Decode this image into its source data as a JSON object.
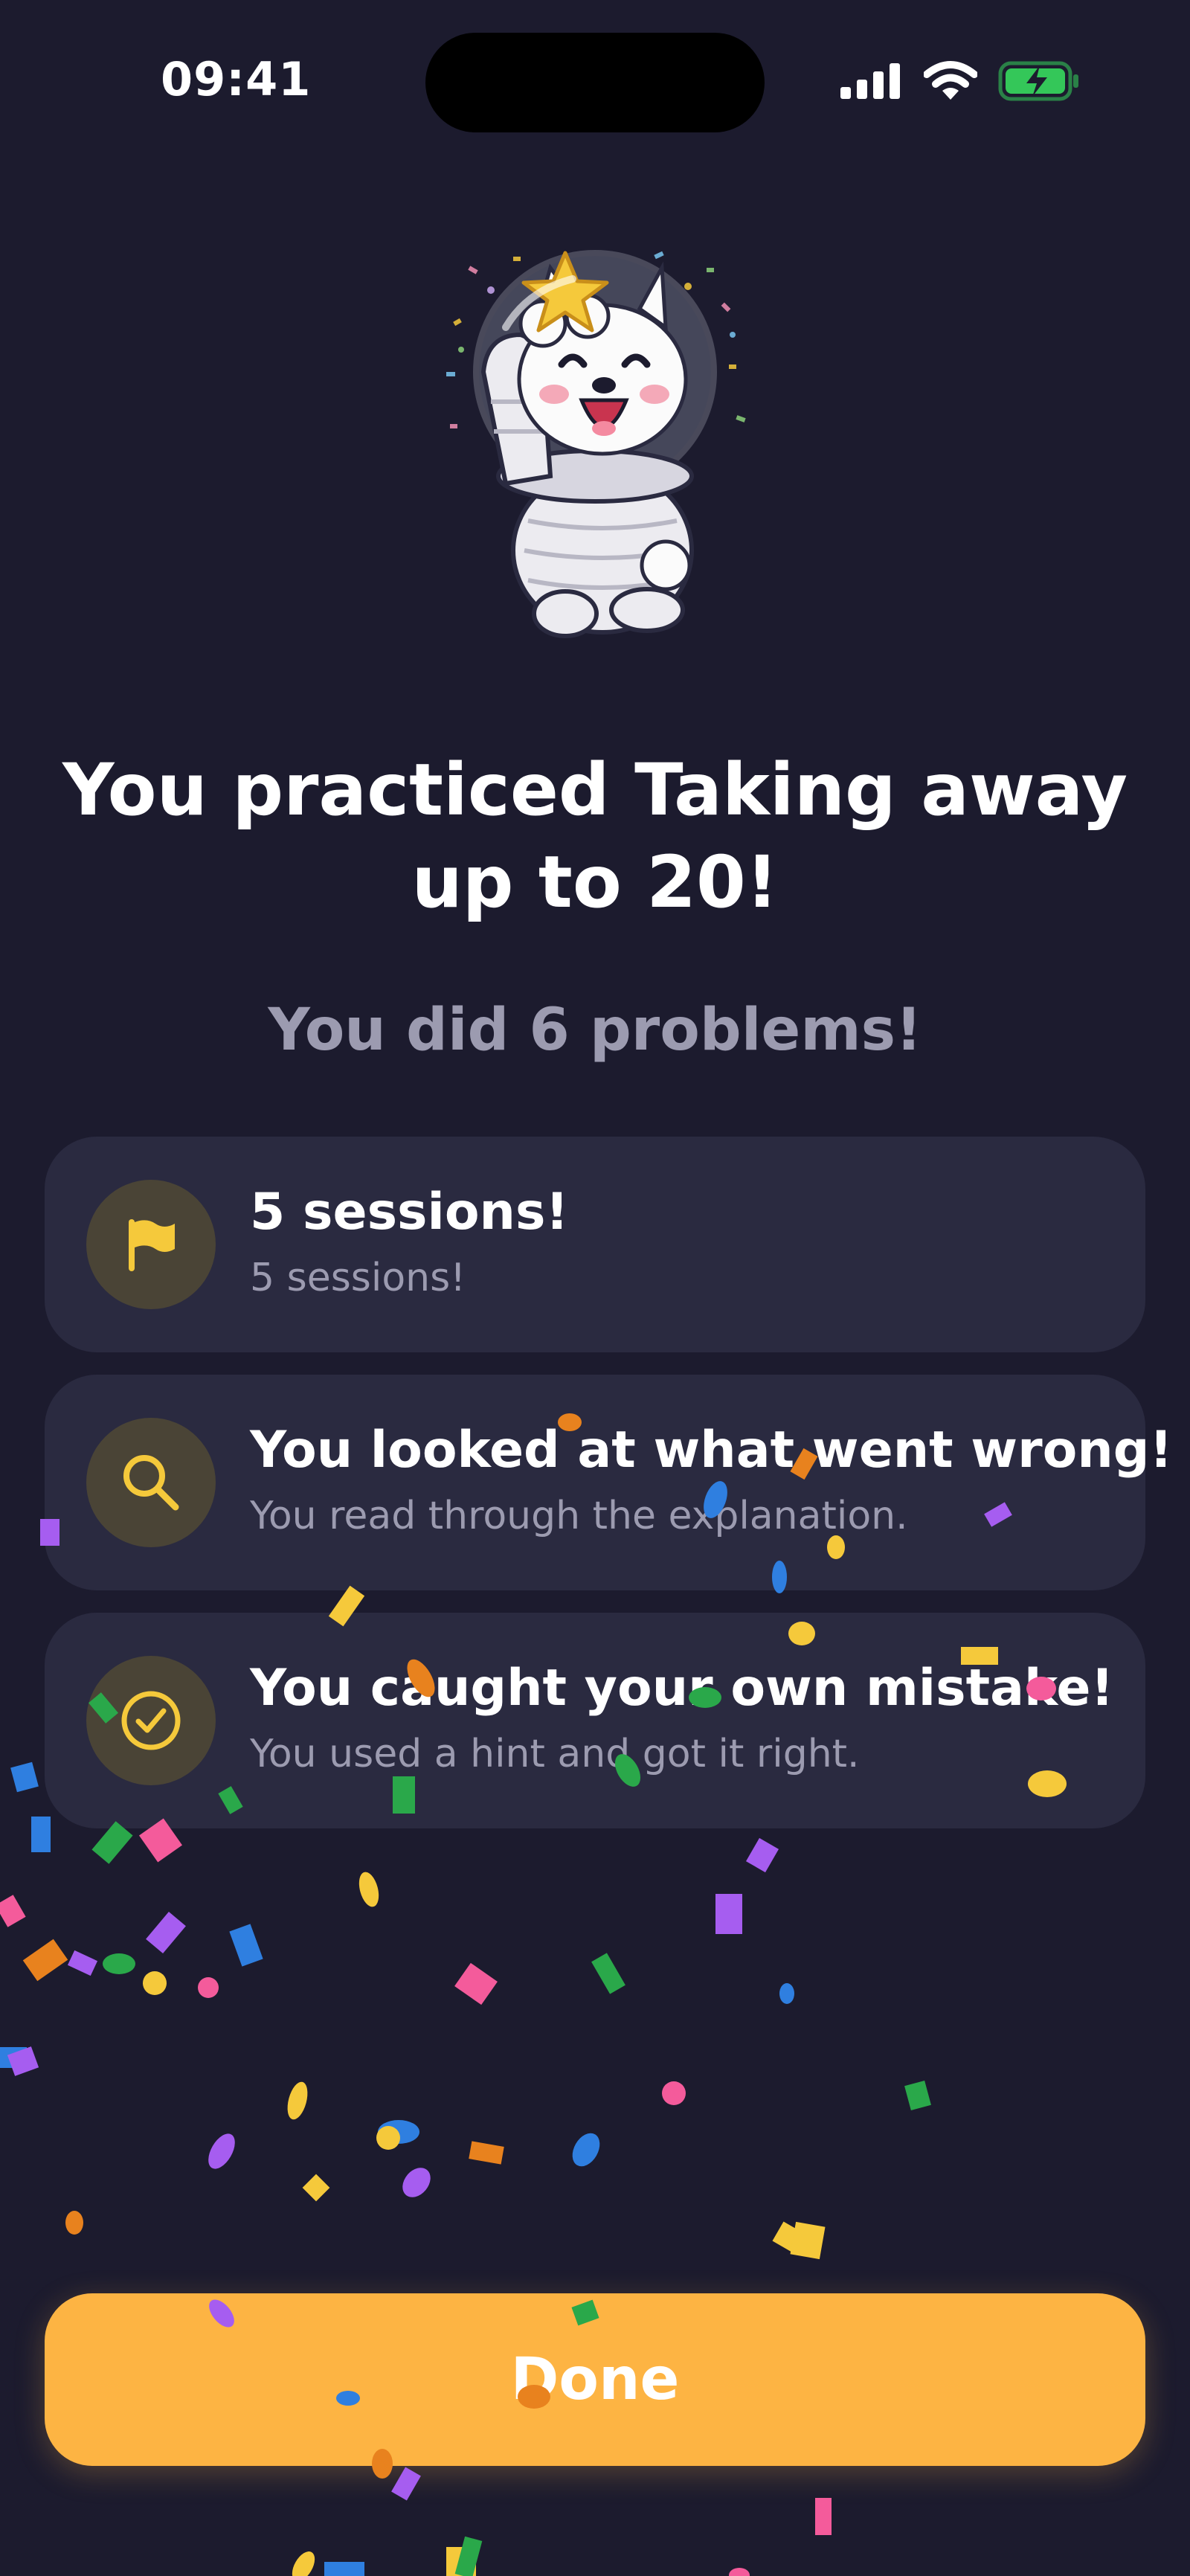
{
  "status_bar": {
    "time": "09:41",
    "icons": [
      "signal-icon",
      "wifi-icon",
      "battery-charging-icon"
    ]
  },
  "hero": {
    "image": "astronaut-dog-celebrating-with-star-illustration"
  },
  "title": "You practiced Taking away up to 20!",
  "subtitle": "You did 6 problems!",
  "achievements": [
    {
      "icon": "flag-icon",
      "title": "5 sessions!",
      "subtitle": "5 sessions!"
    },
    {
      "icon": "magnifier-icon",
      "title": "You looked at what went wrong!",
      "subtitle": "You read through the explanation."
    },
    {
      "icon": "check-circle-icon",
      "title": "You caught your own mistake!",
      "subtitle": "You used a hint and got it right."
    }
  ],
  "done_label": "Done",
  "colors": {
    "background": "#1c1b2e",
    "card": "#2a2a40",
    "accent": "#fdb443",
    "icon_yellow": "#f5c93b",
    "muted_text": "#9c9bb0",
    "battery_green": "#34c759"
  }
}
